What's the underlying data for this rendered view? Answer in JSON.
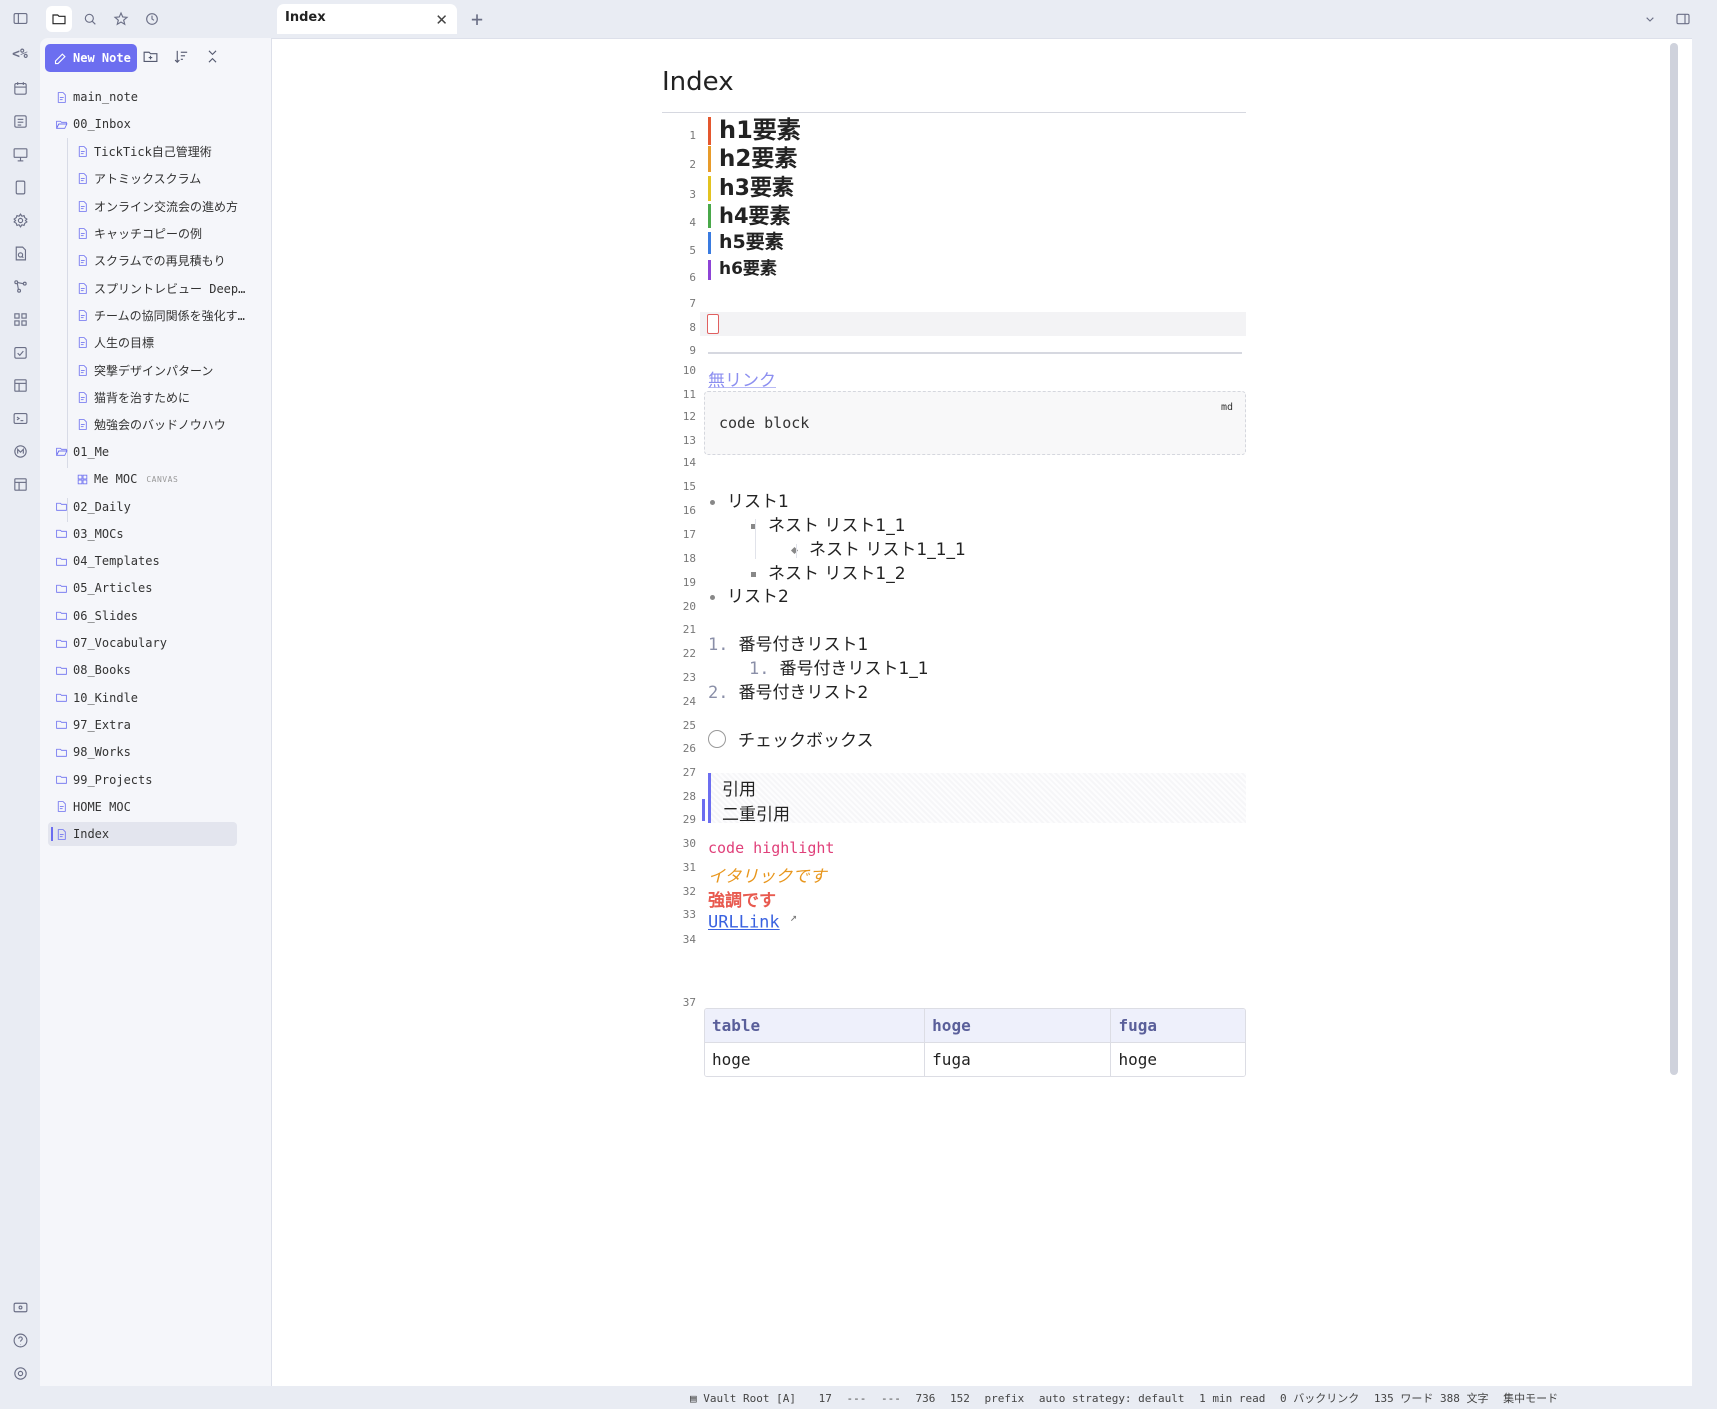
{
  "ribbon": {
    "items": [
      "sidebar-toggle",
      "code-toggle",
      "calendar",
      "list",
      "slides",
      "tablet",
      "graph-plugin",
      "search-file",
      "graph-view",
      "dashboard",
      "tasks",
      "kanban",
      "terminal",
      "mermaid",
      "template"
    ],
    "bottom": [
      "vault-switch",
      "help",
      "settings"
    ],
    "code_label": "<%"
  },
  "topbar": {
    "tab_title": "Index",
    "close_glyph": "✕",
    "new_tab_glyph": "+",
    "chevron_glyph": "⌄"
  },
  "sidebar": {
    "new_note_label": "New Note",
    "tree": [
      {
        "label": "main_note",
        "type": "note",
        "depth": 0
      },
      {
        "label": "00_Inbox",
        "type": "folder-open",
        "depth": 0
      },
      {
        "label": "TickTick自己管理術",
        "type": "note",
        "depth": 1
      },
      {
        "label": "アトミックスクラム",
        "type": "note",
        "depth": 1
      },
      {
        "label": "オンライン交流会の進め方",
        "type": "note",
        "depth": 1
      },
      {
        "label": "キャッチコピーの例",
        "type": "note",
        "depth": 1
      },
      {
        "label": "スクラムでの再見積もり",
        "type": "note",
        "depth": 1
      },
      {
        "label": "スプリントレビュー Deep…",
        "type": "note",
        "depth": 1
      },
      {
        "label": "チームの協同関係を強化す…",
        "type": "note",
        "depth": 1
      },
      {
        "label": "人生の目標",
        "type": "note",
        "depth": 1
      },
      {
        "label": "突撃デザインパターン",
        "type": "note",
        "depth": 1
      },
      {
        "label": "猫背を治すために",
        "type": "note",
        "depth": 1
      },
      {
        "label": "勉強会のバッドノウハウ",
        "type": "note",
        "depth": 1
      },
      {
        "label": "01_Me",
        "type": "folder-open",
        "depth": 0
      },
      {
        "label": "Me MOC",
        "type": "canvas",
        "depth": 1,
        "badge": "CANVAS"
      },
      {
        "label": "02_Daily",
        "type": "folder",
        "depth": 0
      },
      {
        "label": "03_MOCs",
        "type": "folder",
        "depth": 0
      },
      {
        "label": "04_Templates",
        "type": "folder",
        "depth": 0
      },
      {
        "label": "05_Articles",
        "type": "folder",
        "depth": 0
      },
      {
        "label": "06_Slides",
        "type": "folder",
        "depth": 0
      },
      {
        "label": "07_Vocabulary",
        "type": "folder",
        "depth": 0
      },
      {
        "label": "08_Books",
        "type": "folder",
        "depth": 0
      },
      {
        "label": "10_Kindle",
        "type": "folder",
        "depth": 0
      },
      {
        "label": "97_Extra",
        "type": "folder",
        "depth": 0
      },
      {
        "label": "98_Works",
        "type": "folder",
        "depth": 0
      },
      {
        "label": "99_Projects",
        "type": "folder",
        "depth": 0
      },
      {
        "label": "HOME MOC",
        "type": "note",
        "depth": 0
      },
      {
        "label": "Index",
        "type": "note",
        "depth": 0,
        "selected": true
      }
    ]
  },
  "editor": {
    "title": "Index",
    "line_numbers": [
      "1",
      "2",
      "3",
      "4",
      "5",
      "6",
      "7",
      "8",
      "9",
      "10",
      "11",
      "12",
      "13",
      "14",
      "15",
      "16",
      "17",
      "18",
      "19",
      "20",
      "21",
      "22",
      "23",
      "24",
      "25",
      "26",
      "27",
      "28",
      "29",
      "30",
      "31",
      "32",
      "33",
      "34",
      "37"
    ],
    "headings": [
      {
        "text": "h1要素",
        "color": "#e4572e"
      },
      {
        "text": "h2要素",
        "color": "#e89b2a"
      },
      {
        "text": "h3要素",
        "color": "#e3c320"
      },
      {
        "text": "h4要素",
        "color": "#4aa84a"
      },
      {
        "text": "h5要素",
        "color": "#3a7be0"
      },
      {
        "text": "h6要素",
        "color": "#8e44d6"
      }
    ],
    "unlinked_text": "無リンク",
    "code_block": {
      "lang": "md",
      "content": "code block"
    },
    "bullets": [
      {
        "text": "リスト1",
        "level": 0
      },
      {
        "text": "ネスト  リスト1_1",
        "level": 1
      },
      {
        "text": "ネスト  リスト1_1_1",
        "level": 2
      },
      {
        "text": "ネスト  リスト1_2",
        "level": 1
      },
      {
        "text": "リスト2",
        "level": 0
      }
    ],
    "ordered": [
      {
        "num": "1.",
        "text": "番号付きリスト1",
        "level": 0
      },
      {
        "num": "1.",
        "text": "番号付きリスト1_1",
        "level": 1
      },
      {
        "num": "2.",
        "text": "番号付きリスト2",
        "level": 0
      }
    ],
    "checkbox_text": "チェックボックス",
    "quote_lines": [
      "引用",
      "二重引用"
    ],
    "code_highlight": "code highlight",
    "italic_text": "イタリックです",
    "bold_text": "強調です",
    "url_link": "URLLink",
    "table": {
      "headers": [
        "table",
        "hoge",
        "fuga"
      ],
      "rows": [
        [
          "hoge",
          "fuga",
          "hoge"
        ]
      ]
    }
  },
  "statusbar": {
    "vault": "Vault Root [A]",
    "items": [
      "17",
      "---",
      "---",
      "736",
      "152",
      "prefix",
      "auto  strategy: default",
      "1 min read",
      "0 バックリンク",
      "135 ワード 388 文字",
      "集中モード"
    ]
  },
  "colors": {
    "accent": "#6c6ef0",
    "code_highlight": "#e0407a",
    "italic": "#e8961c",
    "bold": "#e85a4f",
    "link": "#3a62e0"
  }
}
